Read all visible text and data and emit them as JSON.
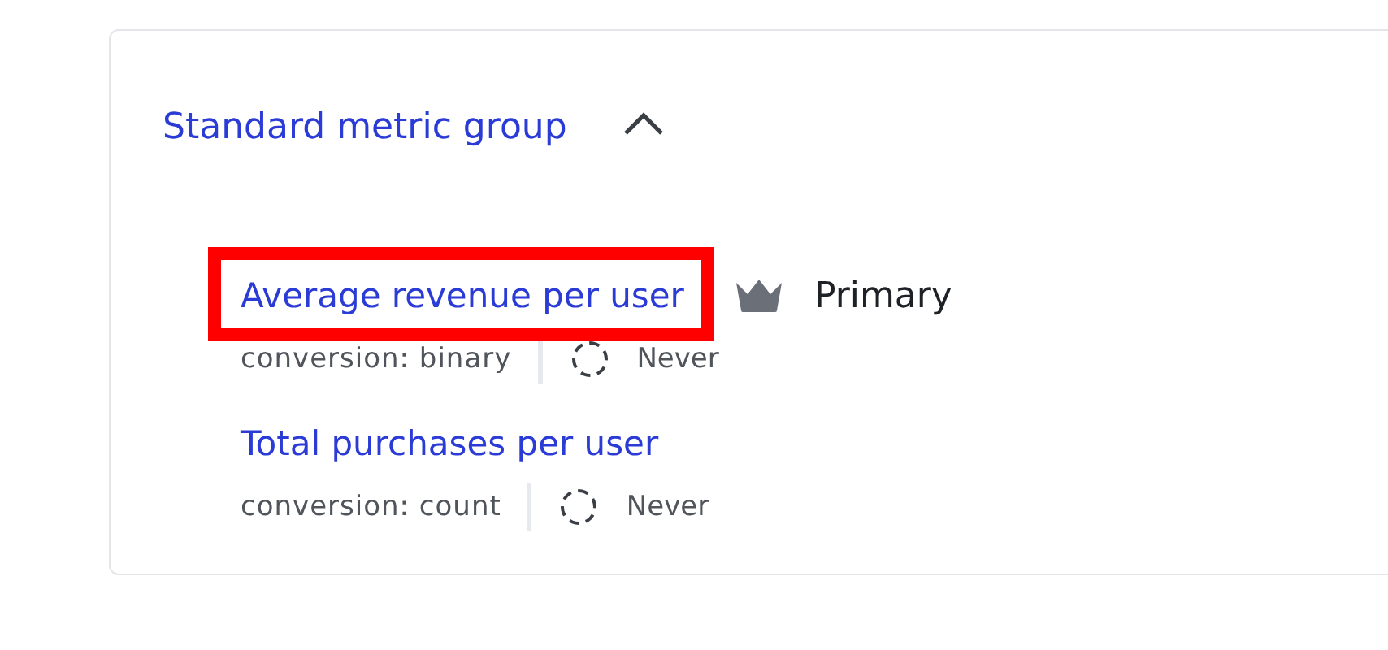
{
  "group": {
    "title": "Standard metric group",
    "expanded": true,
    "metrics": [
      {
        "name": "Average revenue per user",
        "highlighted": true,
        "badge": "Primary",
        "conversion": "conversion: binary",
        "schedule": "Never"
      },
      {
        "name": "Total purchases per user",
        "highlighted": false,
        "conversion": "conversion: count",
        "schedule": "Never"
      }
    ]
  }
}
